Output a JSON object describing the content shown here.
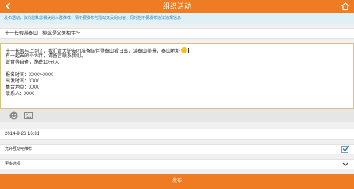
{
  "header": {
    "title": "组织活动",
    "back_icon": "back-arrow-icon",
    "home_icon": "home-icon"
  },
  "notice": {
    "text": "发布活动，仅向您和您相关的人群推荐，请不要发布与活动无关的内容，同时也不要发布违法违规信息"
  },
  "form": {
    "title_value": "十一长假游泰山，抑或是文关相伴～",
    "body_lines": [
      "十一长假马上到了，我们青大驴友团准备结伴登泰山看日出，游泰山美景，泰山地址",
      "有一起去的小伙伴，请留言联系我们。",
      "饭食等自备，路费10元/人",
      "",
      "报名时间：XXX～XXX",
      "出发时间：XXX",
      "集合地点：XXX",
      "联系人：XXX"
    ],
    "datetime": "2014-9-26 16:31",
    "interact_label": "允许互动吧推荐",
    "interact_checked": true,
    "more_label": "更多选项",
    "publish_label": "发布"
  },
  "toolbar": {
    "emoji_icon": "emoji-icon",
    "photo_icon": "image-icon"
  },
  "colors": {
    "accent": "#ef7b22",
    "notice_bg": "#dff0f7",
    "notice_text": "#2f7fb0",
    "textarea_border": "#d8c280"
  }
}
